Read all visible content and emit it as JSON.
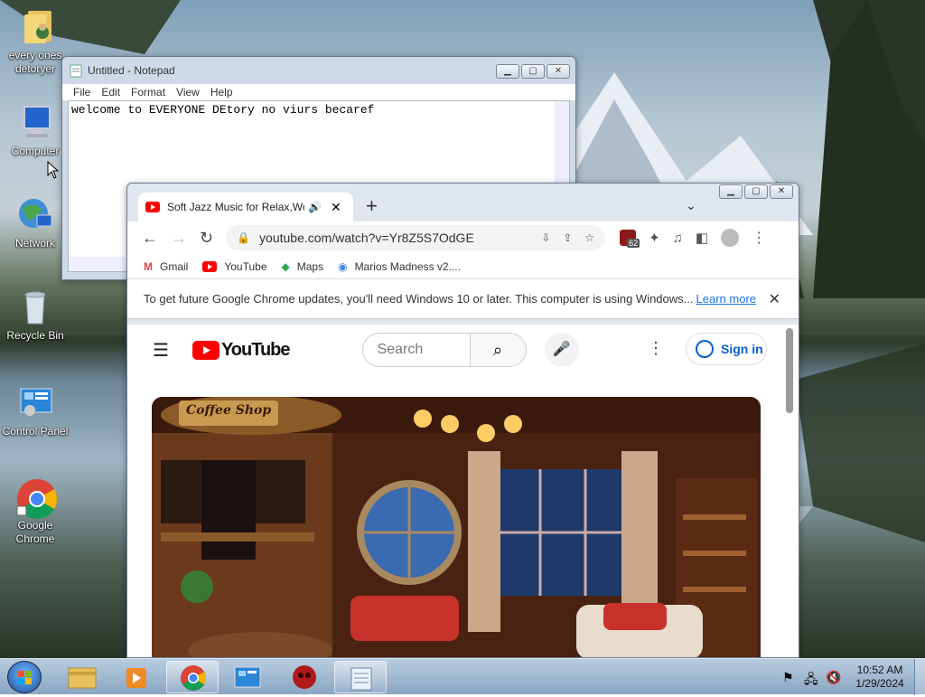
{
  "desktop_icons": [
    {
      "label": "every ones detoryer"
    },
    {
      "label": "Computer"
    },
    {
      "label": "Network"
    },
    {
      "label": "Recycle Bin"
    },
    {
      "label": "Control Panel"
    },
    {
      "label": "Google Chrome"
    }
  ],
  "notepad": {
    "title": "Untitled - Notepad",
    "menu": [
      "File",
      "Edit",
      "Format",
      "View",
      "Help"
    ],
    "content": "welcome to EVERYONE DEtory no viurs becaref"
  },
  "chrome": {
    "tab_title": "Soft Jazz Music for Relax,Wo",
    "new_tab_symbol": "+",
    "url": "youtube.com/watch?v=Yr8Z5S7OdGE",
    "extension_badge": "62",
    "bookmarks": [
      "Gmail",
      "YouTube",
      "Maps",
      "Marios Madness v2...."
    ],
    "infobar_text": "To get future Google Chrome updates, you'll need Windows 10 or later. This computer is using Windows...",
    "infobar_link": "Learn more",
    "youtube": {
      "logo_text": "YouTube",
      "search_placeholder": "Search",
      "sign_in": "Sign in"
    },
    "video_sign": "Coffee Shop"
  },
  "taskbar": {
    "time": "10:52 AM",
    "date": "1/29/2024"
  },
  "colors": {
    "youtube_red": "#ff0000",
    "link_blue": "#1a73e8"
  }
}
